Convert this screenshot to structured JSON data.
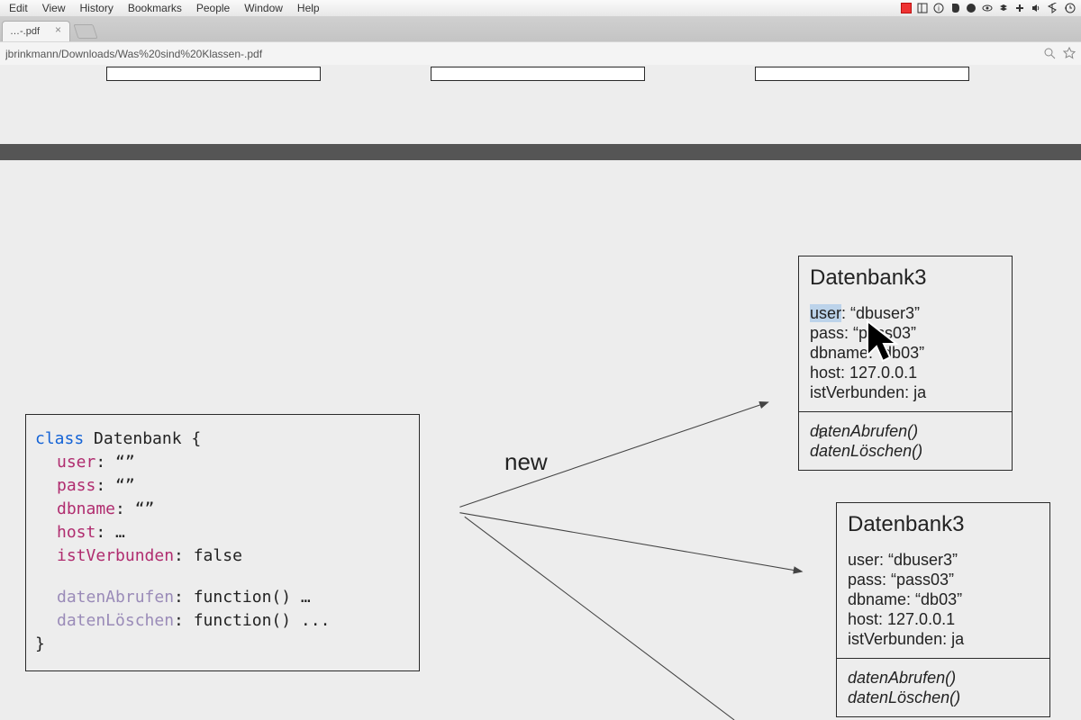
{
  "menubar": {
    "items": [
      "Edit",
      "View",
      "History",
      "Bookmarks",
      "People",
      "Window",
      "Help"
    ]
  },
  "tab": {
    "title": "…-.pdf",
    "close_glyph": "×"
  },
  "omnibox": {
    "url": "jbrinkmann/Downloads/Was%20sind%20Klassen-.pdf"
  },
  "diagram": {
    "new_label": "new",
    "class_box": {
      "l1a": "class",
      "l1b": " Datenbank {",
      "f1": "user",
      "f1v": ": “”",
      "f2": "pass",
      "f2v": ": “”",
      "f3": "dbname",
      "f3v": ": “”",
      "f4": "host",
      "f4v": ": …",
      "f5": "istVerbunden",
      "f5v": ": false",
      "m1": "datenAbrufen",
      "m1v": ": function() …",
      "m2": "datenLöschen",
      "m2v": ": function() ...",
      "close": "}"
    },
    "instance1": {
      "title": "Datenbank3",
      "attrs": [
        "user: “dbuser3”",
        "pass: “pass03”",
        "dbname: “db03”",
        "host: 127.0.0.1",
        "istVerbunden: ja"
      ],
      "methods": [
        "datenAbrufen()",
        "datenLöschen()"
      ]
    },
    "instance2": {
      "title": "Datenbank3",
      "attrs": [
        "user: “dbuser3”",
        "pass: “pass03”",
        "dbname: “db03”",
        "host: 127.0.0.1",
        "istVerbunden: ja"
      ],
      "methods": [
        "datenAbrufen()",
        "datenLöschen()"
      ]
    }
  }
}
